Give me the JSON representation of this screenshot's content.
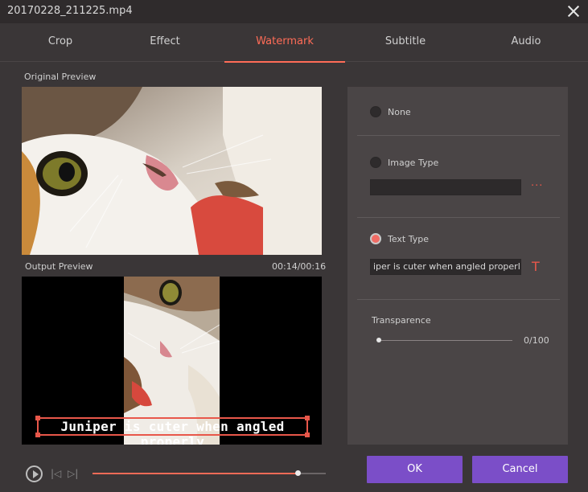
{
  "window": {
    "title": "20170228_211225.mp4"
  },
  "tabs": [
    {
      "label": "Crop"
    },
    {
      "label": "Effect"
    },
    {
      "label": "Watermark"
    },
    {
      "label": "Subtitle"
    },
    {
      "label": "Audio"
    }
  ],
  "active_tab": "Watermark",
  "preview": {
    "original_label": "Original Preview",
    "output_label": "Output Preview",
    "timecode": "00:14/00:16",
    "watermark_text": "Juniper is cuter when angled properly"
  },
  "watermark": {
    "options": [
      {
        "label": "None",
        "selected": false
      },
      {
        "label": "Image Type",
        "selected": false
      },
      {
        "label": "Text Type",
        "selected": true
      }
    ],
    "image_field_value": "",
    "image_browse_label": "···",
    "text_field_value": "iper is cuter when angled properly",
    "text_icon": "T",
    "transparence_label": "Transparence",
    "transparence_value_text": "0/100",
    "transparence_value": 0
  },
  "playback": {
    "progress_fraction": 0.88
  },
  "buttons": {
    "ok": "OK",
    "cancel": "Cancel"
  },
  "colors": {
    "accent": "#ff6c57",
    "button": "#7b4ec8",
    "background": "#3a3637"
  },
  "icons": {
    "close": "close-icon",
    "play": "play-icon",
    "prev": "skip-back-icon",
    "next": "skip-forward-icon",
    "text_style": "text-style-icon",
    "browse": "browse-icon"
  }
}
